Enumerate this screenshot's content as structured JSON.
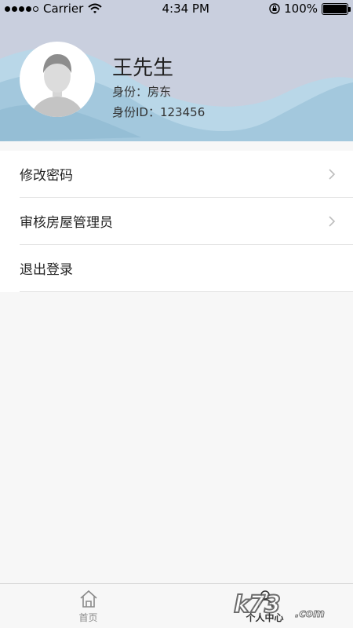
{
  "status_bar": {
    "carrier": "Carrier",
    "time": "4:34 PM",
    "battery": "100%",
    "battery_level": 1.0,
    "icons": [
      "signal-dots-icon",
      "wifi-icon",
      "rotation-lock-icon",
      "battery-icon"
    ]
  },
  "profile": {
    "name": "王先生",
    "role": "身份：房东",
    "id": "身份ID：123456",
    "avatar_icon": "default-avatar-icon"
  },
  "menu": {
    "items": [
      {
        "label": "修改密码",
        "has_chevron": true
      },
      {
        "label": "审核房屋管理员",
        "has_chevron": true
      },
      {
        "label": "退出登录",
        "has_chevron": false
      }
    ]
  },
  "tab_bar": {
    "tabs": [
      {
        "label": "首页",
        "icon": "home-icon",
        "active": false
      },
      {
        "label": "个人中心",
        "icon": "person-icon",
        "active": true
      }
    ]
  },
  "watermark": {
    "text": "k73.com"
  },
  "colors": {
    "header_bg": "#c9cfde",
    "wave_light": "#b7d6e8",
    "wave_dark": "#93bdd6",
    "page_bg": "#f7f7f7"
  }
}
